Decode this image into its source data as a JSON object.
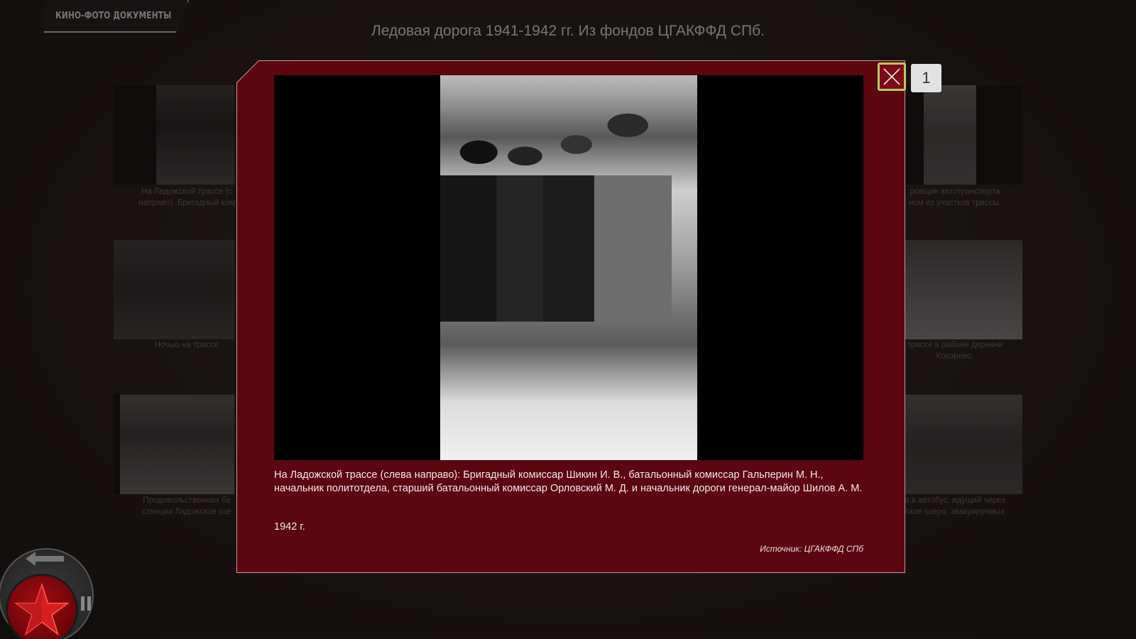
{
  "section_tab": {
    "label": "КИНО-ФОТО ДОКУМЕНТЫ"
  },
  "page_title": "Ледовая дорога 1941-1942 гг. Из фондов ЦГАКФФД СПб.",
  "gallery": {
    "left": [
      {
        "caption": "На Ладожской трассе (с\nнаправо). Бригадный ком"
      },
      {
        "caption": "Ночью на трассе"
      },
      {
        "caption": "Продовольственная ба\nстанции Ладожское озе"
      }
    ],
    "right": [
      {
        "caption": "ровщик автотранспорта\nном из участков трассы."
      },
      {
        "caption": "трассе в районе деревни\nКокорево."
      },
      {
        "caption": "а в автобус, идущий через\nское озеро, эвакуируемых"
      }
    ]
  },
  "modal": {
    "photo_alt": "",
    "caption": "На Ладожской трассе (слева направо): Бригадный комиссар Шикин И. В., батальонный комиссар Гальперин М. Н., начальник политотдела, старший батальонный комиссар Орловский М. Д. и начальник дороги генерал-майор Шилов А. М.",
    "year": "1942 г.",
    "source": "Источник: ЦГАКФФД СПб",
    "counter": "1"
  },
  "colors": {
    "modal_bg": "#5c0610",
    "close_border": "#b7cc5d",
    "counter_bg": "#e2e2e2",
    "star": "#d81e22"
  },
  "icons": {
    "close": "close-icon",
    "star": "red-star-icon",
    "back": "back-arrow-icon",
    "pause": "pause-icon"
  }
}
